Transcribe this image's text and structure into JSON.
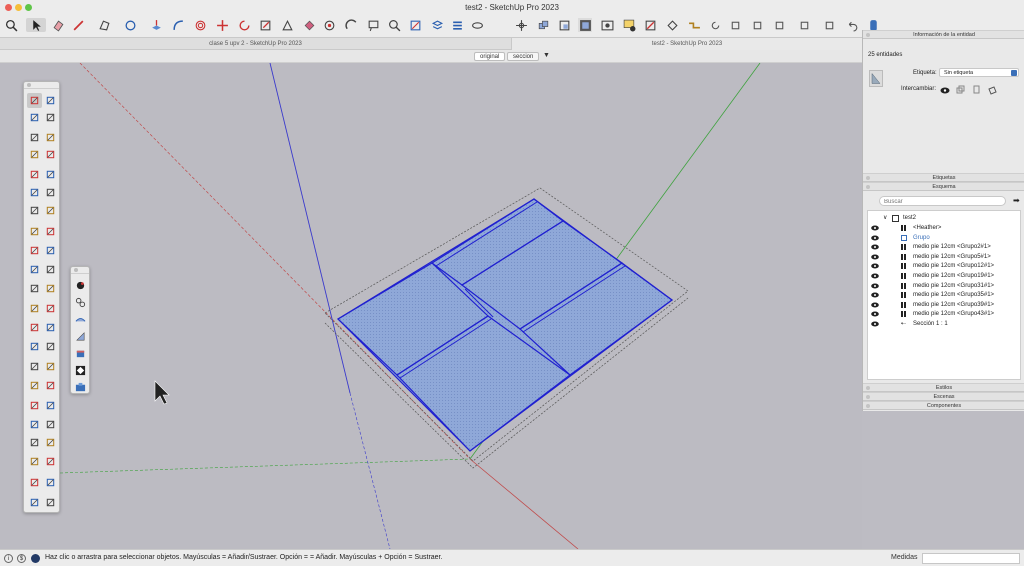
{
  "window": {
    "title": "test2 - SketchUp Pro 2023"
  },
  "tabs": [
    {
      "label": "clase 5 upv 2 - SketchUp Pro 2023"
    },
    {
      "label": "test2 - SketchUp Pro 2023"
    }
  ],
  "scenes": {
    "items": [
      "original",
      "seccion"
    ],
    "menu_icon": "triangle-down-icon"
  },
  "tray": {
    "entity_info": {
      "title": "Información de la entidad",
      "count": "25 entidades",
      "tag_label": "Etiqueta:",
      "tag_value": "Sin etiqueta",
      "toggle_label": "Intercambiar:"
    },
    "tags_panel": {
      "title": "Etiquetas"
    },
    "outliner": {
      "title": "Esquema",
      "search_placeholder": "Buscar",
      "root": "test2",
      "items": [
        {
          "label": "<Heather>",
          "icon": "component-icon"
        },
        {
          "label": "Grupo",
          "icon": "group-icon"
        },
        {
          "label": "medio pie 12cm <Grupo2#1>",
          "icon": "component-icon"
        },
        {
          "label": "medio pie 12cm <Grupo5#1>",
          "icon": "component-icon"
        },
        {
          "label": "medio pie 12cm <Grupo12#1>",
          "icon": "component-icon"
        },
        {
          "label": "medio pie 12cm <Grupo19#1>",
          "icon": "component-icon"
        },
        {
          "label": "medio pie 12cm <Grupo31#1>",
          "icon": "component-icon"
        },
        {
          "label": "medio pie 12cm <Grupo35#1>",
          "icon": "component-icon"
        },
        {
          "label": "medio pie 12cm <Grupo39#1>",
          "icon": "component-icon"
        },
        {
          "label": "medio pie 12cm <Grupo43#1>",
          "icon": "component-icon"
        },
        {
          "label": "Sección 1 : 1",
          "icon": "section-plane-icon"
        }
      ]
    },
    "styles_panel": {
      "title": "Estilos"
    },
    "scenes_panel": {
      "title": "Escenas"
    },
    "components_panel": {
      "title": "Componentes"
    }
  },
  "status": {
    "message": "Haz clic o arrastra para seleccionar objetos. Mayúsculas = Añadir/Sustraer. Opción = = Añadir. Mayúsculas + Opción = Sustraer.",
    "measurements_label": "Medidas"
  },
  "colors": {
    "selection": "#2020d0",
    "face_fill": "#8fa8d8",
    "axis_red": "#cc3333",
    "axis_green": "#33aa33",
    "axis_blue": "#3333cc"
  }
}
